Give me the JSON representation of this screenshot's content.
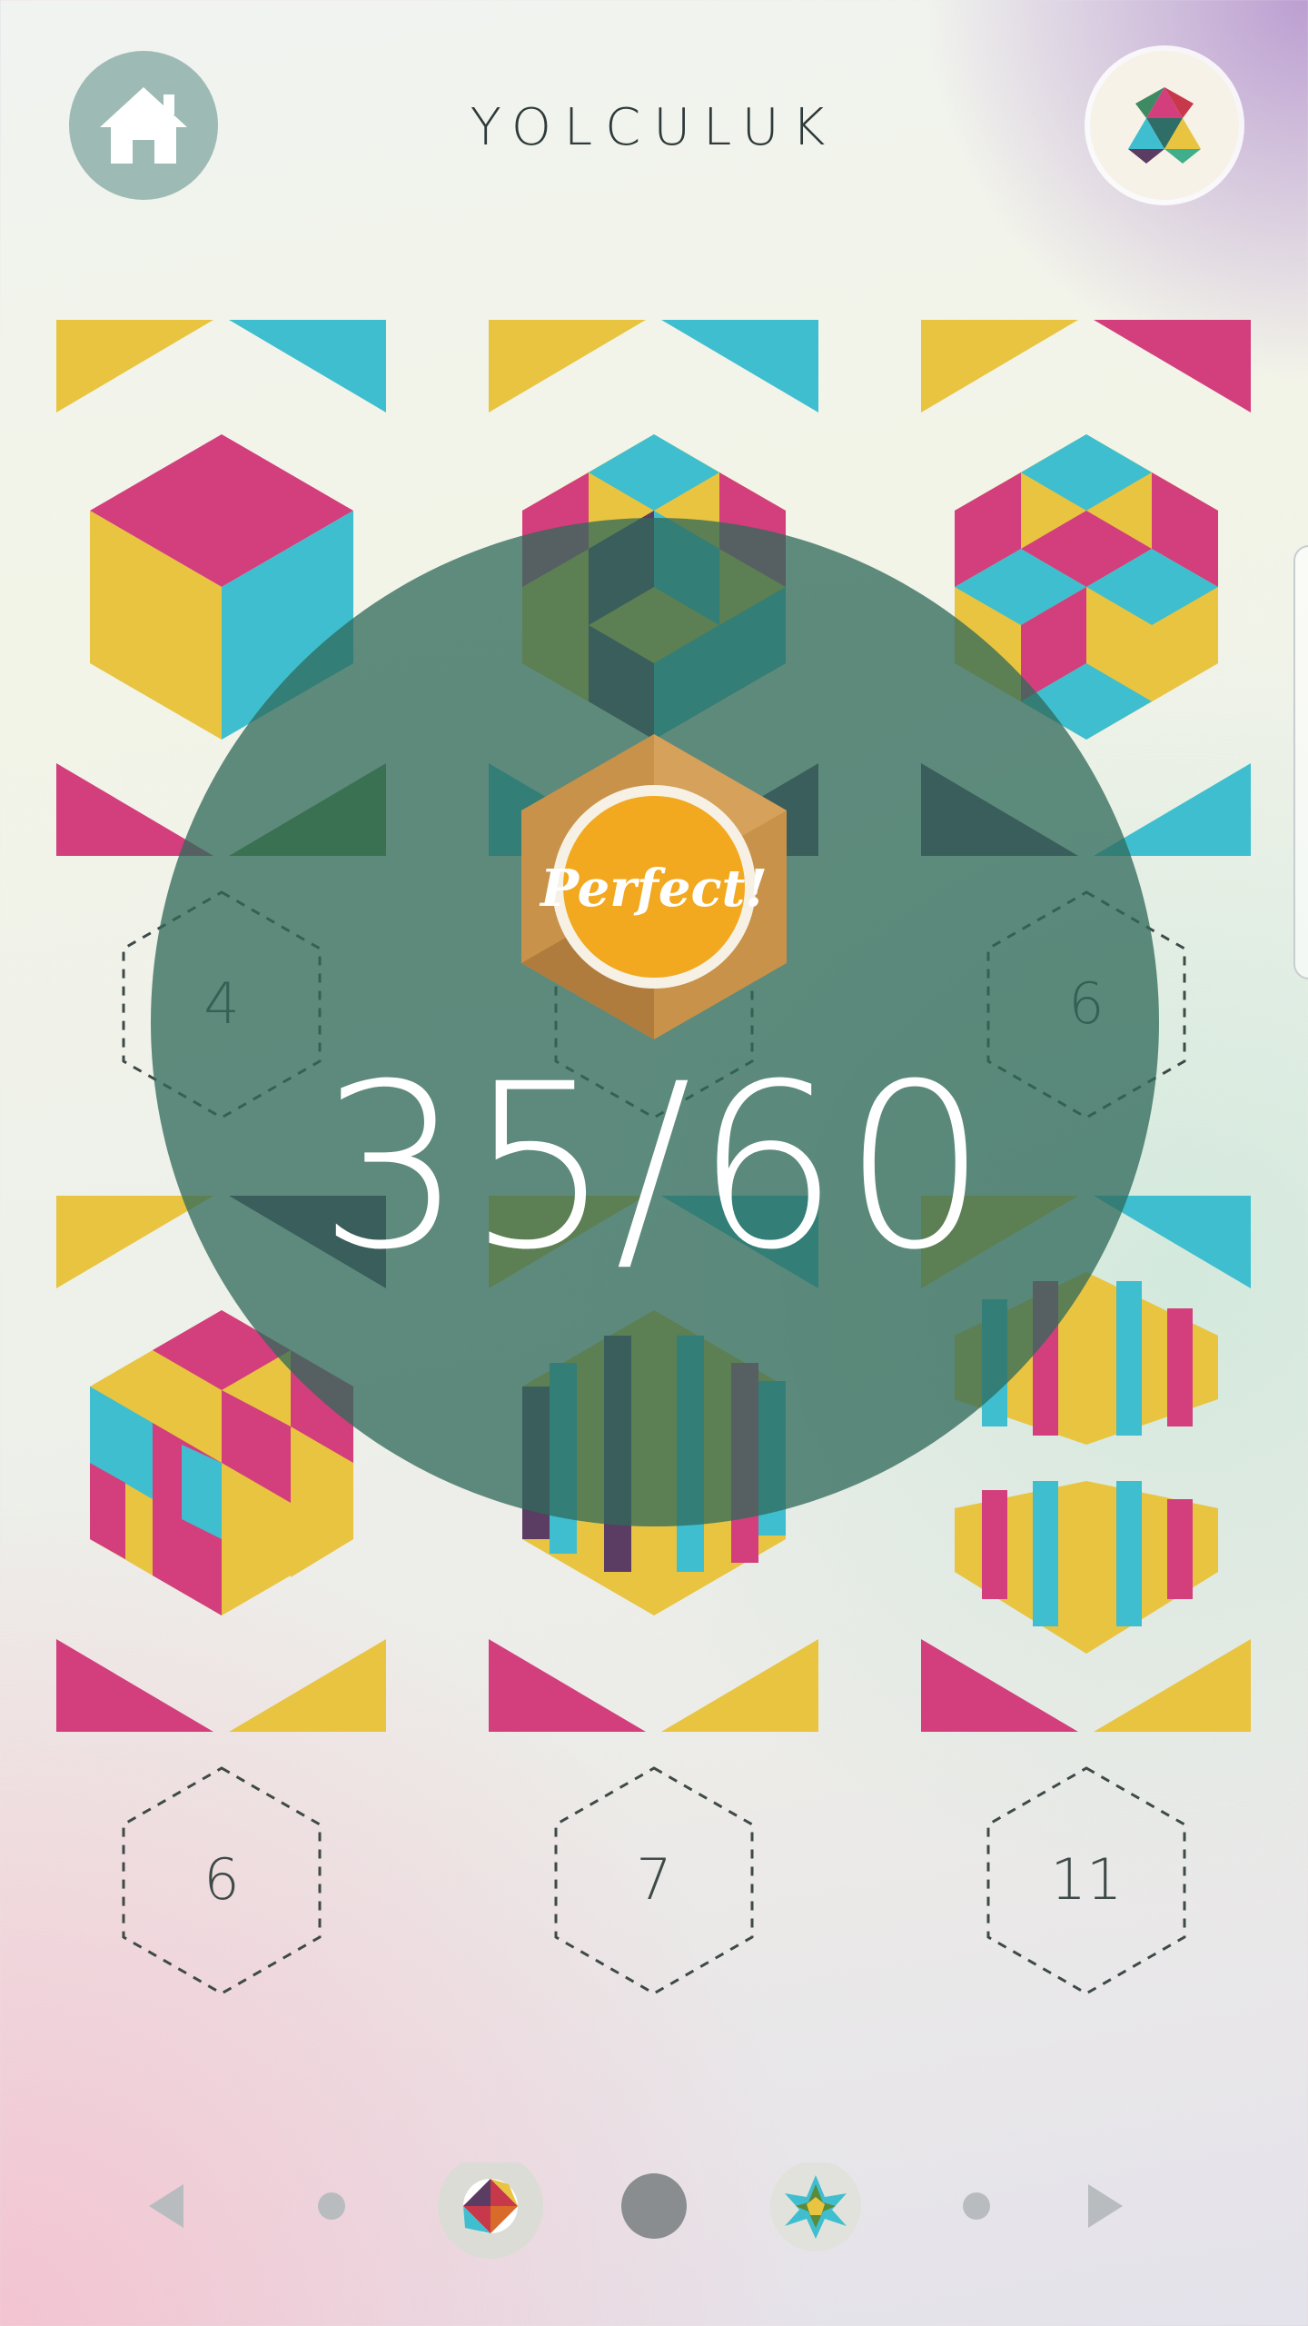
{
  "header": {
    "title": "YOLCULUK",
    "home_icon": "home-icon",
    "badge_icon": "triangle-badge-icon"
  },
  "levels": [
    {
      "name": "level-1",
      "state": "completed",
      "art": "cube"
    },
    {
      "name": "level-2",
      "state": "completed",
      "art": "star-cube"
    },
    {
      "name": "level-3",
      "state": "completed",
      "art": "pinwheel"
    },
    {
      "name": "level-4",
      "state": "locked",
      "required": "4"
    },
    {
      "name": "level-5",
      "state": "locked",
      "required": ""
    },
    {
      "name": "level-6",
      "state": "locked",
      "required": "6"
    },
    {
      "name": "level-7",
      "state": "completed",
      "art": "spiral-cube"
    },
    {
      "name": "level-8",
      "state": "completed",
      "art": "striped"
    },
    {
      "name": "level-9",
      "state": "completed",
      "art": "twin-blocks"
    },
    {
      "name": "level-10",
      "state": "locked",
      "required": "6"
    },
    {
      "name": "level-11",
      "state": "locked",
      "required": "7"
    },
    {
      "name": "level-12",
      "state": "locked",
      "required": "11"
    }
  ],
  "popup": {
    "medal_text": "Perfect!",
    "score": "35/60",
    "score_value": 35,
    "score_total": 60
  },
  "pager": {
    "prev_icon": "arrow-left-icon",
    "next_icon": "arrow-right-icon",
    "current_index": 3,
    "dots": [
      "small-dot",
      "world-icon",
      "current-dot",
      "star-world-icon",
      "small-dot"
    ]
  },
  "colors": {
    "pink": "#d23f7c",
    "cyan": "#3fbecf",
    "yellow": "#e8c440",
    "purple": "#5b3c62",
    "overlay": "#2f695a",
    "medal": "#f2a81f",
    "medal_frame": "#c8924a"
  }
}
